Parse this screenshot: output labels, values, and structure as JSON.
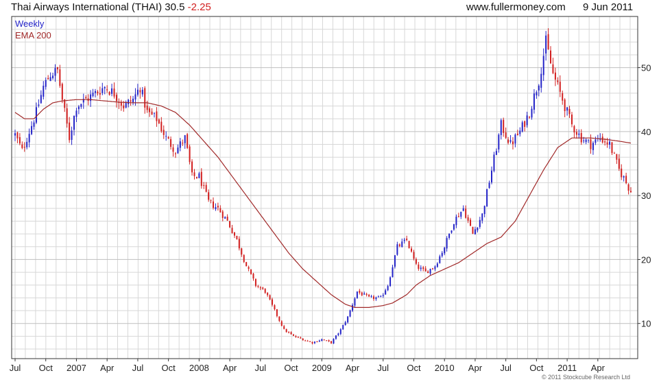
{
  "header": {
    "title": "Thai Airways International (THAI) 30.5",
    "change": "-2.25",
    "site": "www.fullermoney.com",
    "date": "9 Jun 2011"
  },
  "legend": {
    "series1": "Weekly",
    "series2": "EMA 200"
  },
  "copyright": "© 2011 Stockcube Research Ltd",
  "colors": {
    "up": "#2323c8",
    "down": "#d21f1f",
    "ema": "#a02828",
    "grid": "#d7d7d7",
    "axis": "#333333"
  },
  "chart_data": {
    "type": "candlestick",
    "title": "Thai Airways International (THAI) 30.5",
    "ylim": [
      4.5,
      58
    ],
    "yticks": [
      10,
      20,
      30,
      40,
      50
    ],
    "y_scale": "linear",
    "xlim": [
      0,
      261
    ],
    "x_unit": "weeks, Jul 2006 – Jun 2011",
    "grid": true,
    "legend_position": "top-left",
    "x_ticks": [
      {
        "label": "Jul",
        "week": 0
      },
      {
        "label": "Oct",
        "week": 13
      },
      {
        "label": "2007",
        "week": 26
      },
      {
        "label": "Apr",
        "week": 39
      },
      {
        "label": "Jul",
        "week": 52
      },
      {
        "label": "Oct",
        "week": 65
      },
      {
        "label": "2008",
        "week": 78
      },
      {
        "label": "Apr",
        "week": 91
      },
      {
        "label": "Jul",
        "week": 104
      },
      {
        "label": "Oct",
        "week": 117
      },
      {
        "label": "2009",
        "week": 130
      },
      {
        "label": "Apr",
        "week": 143
      },
      {
        "label": "Jul",
        "week": 156
      },
      {
        "label": "Oct",
        "week": 169
      },
      {
        "label": "2010",
        "week": 182
      },
      {
        "label": "Apr",
        "week": 195
      },
      {
        "label": "Jul",
        "week": 208
      },
      {
        "label": "Oct",
        "week": 221
      },
      {
        "label": "2011",
        "week": 234
      },
      {
        "label": "Apr",
        "week": 247
      }
    ],
    "close_anchors": [
      [
        0,
        39.5
      ],
      [
        3,
        37
      ],
      [
        6,
        40
      ],
      [
        9,
        43
      ],
      [
        12,
        47
      ],
      [
        15,
        49
      ],
      [
        18,
        49.5
      ],
      [
        20,
        45
      ],
      [
        23,
        39
      ],
      [
        26,
        44
      ],
      [
        30,
        45
      ],
      [
        34,
        46
      ],
      [
        38,
        47
      ],
      [
        42,
        46
      ],
      [
        46,
        44
      ],
      [
        50,
        45
      ],
      [
        53,
        47
      ],
      [
        56,
        43
      ],
      [
        60,
        42
      ],
      [
        64,
        39
      ],
      [
        68,
        37
      ],
      [
        72,
        39
      ],
      [
        75,
        33
      ],
      [
        78,
        33
      ],
      [
        82,
        29
      ],
      [
        86,
        28
      ],
      [
        90,
        26
      ],
      [
        94,
        23
      ],
      [
        98,
        19
      ],
      [
        102,
        16
      ],
      [
        106,
        15
      ],
      [
        110,
        12
      ],
      [
        114,
        9
      ],
      [
        118,
        8
      ],
      [
        122,
        7.5
      ],
      [
        126,
        7
      ],
      [
        130,
        7.5
      ],
      [
        134,
        7
      ],
      [
        138,
        9
      ],
      [
        141,
        11
      ],
      [
        145,
        15
      ],
      [
        150,
        14
      ],
      [
        155,
        14
      ],
      [
        158,
        16
      ],
      [
        162,
        22
      ],
      [
        166,
        23
      ],
      [
        170,
        19
      ],
      [
        174,
        18
      ],
      [
        178,
        19
      ],
      [
        182,
        22
      ],
      [
        186,
        26
      ],
      [
        190,
        28
      ],
      [
        194,
        24
      ],
      [
        198,
        27
      ],
      [
        202,
        34
      ],
      [
        206,
        41
      ],
      [
        210,
        38
      ],
      [
        214,
        40
      ],
      [
        218,
        43
      ],
      [
        222,
        48
      ],
      [
        225,
        54
      ],
      [
        228,
        49
      ],
      [
        232,
        45
      ],
      [
        236,
        41
      ],
      [
        240,
        39
      ],
      [
        244,
        38
      ],
      [
        248,
        39
      ],
      [
        252,
        38
      ],
      [
        256,
        34
      ],
      [
        258,
        32.75
      ],
      [
        261,
        30.5
      ]
    ],
    "ema_anchors": [
      [
        0,
        43
      ],
      [
        4,
        42
      ],
      [
        8,
        42
      ],
      [
        12,
        43.5
      ],
      [
        16,
        44.5
      ],
      [
        20,
        44.8
      ],
      [
        26,
        45
      ],
      [
        32,
        45
      ],
      [
        38,
        44.8
      ],
      [
        44,
        44.6
      ],
      [
        50,
        44.5
      ],
      [
        56,
        44.5
      ],
      [
        62,
        44
      ],
      [
        68,
        43
      ],
      [
        74,
        41
      ],
      [
        80,
        38.5
      ],
      [
        86,
        36
      ],
      [
        92,
        33
      ],
      [
        98,
        30
      ],
      [
        104,
        27
      ],
      [
        110,
        24
      ],
      [
        116,
        21
      ],
      [
        122,
        18.5
      ],
      [
        128,
        16.5
      ],
      [
        134,
        14.5
      ],
      [
        140,
        13
      ],
      [
        144,
        12.5
      ],
      [
        150,
        12.5
      ],
      [
        156,
        12.8
      ],
      [
        160,
        13.2
      ],
      [
        166,
        14.5
      ],
      [
        170,
        16
      ],
      [
        176,
        17.5
      ],
      [
        182,
        18.5
      ],
      [
        188,
        19.5
      ],
      [
        194,
        21
      ],
      [
        200,
        22.5
      ],
      [
        206,
        23.5
      ],
      [
        212,
        26
      ],
      [
        218,
        30
      ],
      [
        224,
        34
      ],
      [
        230,
        37.5
      ],
      [
        236,
        39
      ],
      [
        244,
        39
      ],
      [
        250,
        38.8
      ],
      [
        256,
        38.5
      ],
      [
        261,
        38.2
      ]
    ]
  }
}
